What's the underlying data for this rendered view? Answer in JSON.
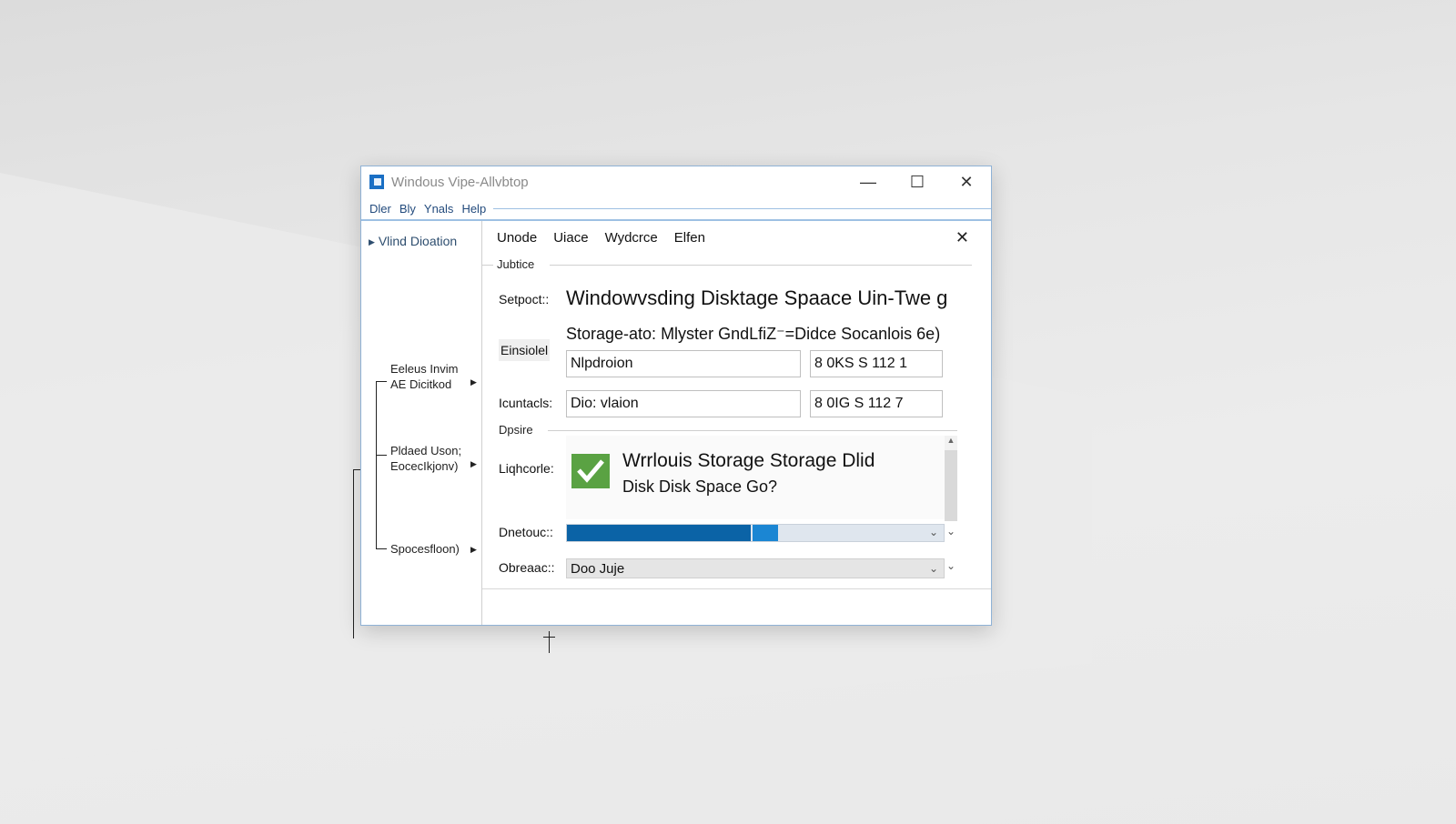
{
  "window": {
    "title": "Windous Vipe-Allvbtop",
    "controls": {
      "minimize": "—",
      "maximize": "☐",
      "close": "✕"
    }
  },
  "menu": [
    "Dler",
    "Bly",
    "Ynals",
    "Help"
  ],
  "sidebar": {
    "top_item": "Vlind Dioation",
    "tree": [
      {
        "label_line1": "Eeleus Invim",
        "label_line2": "AE Dicitkod"
      },
      {
        "label_line1": "Pldaed Uson;",
        "label_line2": "EocecIkjonv)"
      },
      {
        "label_line1": "Spocesfloon)",
        "label_line2": ""
      }
    ]
  },
  "content": {
    "tabs": [
      "Unode",
      "Uiace",
      "Wydcrce",
      "Elfen"
    ],
    "close": "✕",
    "group1_label": "Jubtice",
    "setpoint_label": "Setpoct::",
    "heading": "Windowvsding Disktage Spaace Uin-Twe g",
    "subheading": "Storage-ato: Mlyster GndLfiZ⁻=Didce Socanlois 6e)",
    "einsiolel_label": "Einsiolel",
    "field1_name": "Nlpdroion",
    "field1_value": "8 0KS S 112   1",
    "row2_label": "Icuntacls:",
    "field2_name": "Dio: vlaion",
    "field2_value": "8 0IG S 112   7",
    "group2_label": "Dpsire",
    "result_label": "Liqhcorle:",
    "result_title": "Wrrlouis Storage Storage Dlid",
    "result_sub": "Disk Disk Space Go?",
    "progress_label": "Dnetouc::",
    "progress_fraction": 0.56,
    "combo_label": "Obreaac::",
    "combo_value": "Doo Juje"
  }
}
